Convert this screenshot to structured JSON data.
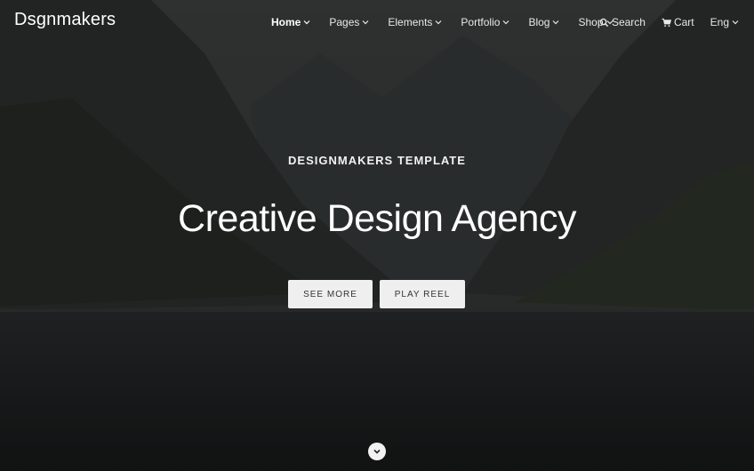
{
  "brand": {
    "logo_text": "Dsgnmakers"
  },
  "nav": {
    "items": [
      {
        "label": "Home",
        "active": true
      },
      {
        "label": "Pages"
      },
      {
        "label": "Elements"
      },
      {
        "label": "Portfolio"
      },
      {
        "label": "Blog"
      },
      {
        "label": "Shop"
      }
    ],
    "search_label": "Search",
    "cart_label": "Cart",
    "language_label": "Eng"
  },
  "hero": {
    "subtitle": "DESIGNMAKERS TEMPLATE",
    "title": "Creative Design Agency",
    "primary_button": "SEE MORE",
    "secondary_button": "PLAY REEL"
  },
  "icons": {
    "search": "search-icon",
    "cart": "cart-icon",
    "chevron": "chevron-down-icon",
    "scroll": "scroll-down-icon"
  },
  "colors": {
    "overlay": "#1b1d1d",
    "button_bg": "#efefef",
    "button_text": "#333333"
  }
}
